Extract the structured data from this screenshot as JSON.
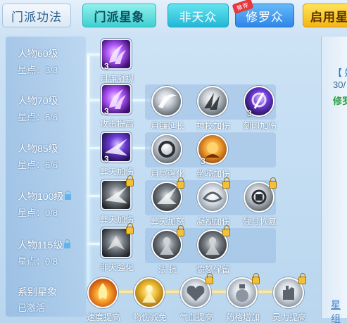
{
  "tabs": [
    {
      "label": "门派功法",
      "style": "plain",
      "active": false
    },
    {
      "label": "门派星象",
      "style": "active",
      "active": true
    },
    {
      "label": "非天众",
      "style": "cyan",
      "active": false
    },
    {
      "label": "修罗众",
      "style": "blue",
      "active": false,
      "badge": "推荐"
    },
    {
      "label": "启用星",
      "style": "yellow",
      "active": false
    }
  ],
  "levels": [
    {
      "name": "人物60级",
      "stars": "星点：3/3",
      "locked": false
    },
    {
      "name": "人物70级",
      "stars": "星点：6/6",
      "locked": false
    },
    {
      "name": "人物85级",
      "stars": "星点：6/6",
      "locked": false
    },
    {
      "name": "人物100级",
      "stars": "星点：0/8",
      "locked": true
    },
    {
      "name": "人物115级",
      "stars": "星点：0/8",
      "locked": true
    }
  ],
  "rows": [
    {
      "nodes": [
        {
          "label": "月镰凝视",
          "count": "3",
          "icon": "purple-claw-icon",
          "style": "ic-purple",
          "shape": "sq",
          "locked": false
        }
      ]
    },
    {
      "nodes": [
        {
          "label": "攻击提高",
          "count": "3",
          "icon": "purple-claw-icon",
          "style": "ic-purple",
          "shape": "sq",
          "locked": false
        },
        {
          "label": "月镰延长",
          "count": "",
          "icon": "crescent-blade-icon",
          "style": "ic-grey",
          "shape": "round",
          "locked": false
        },
        {
          "label": "神技加伤",
          "count": "",
          "icon": "claw-slash-icon",
          "style": "ic-grey",
          "shape": "round",
          "locked": false
        },
        {
          "label": "刻印加伤",
          "count": "3",
          "icon": "purple-rune-icon",
          "style": "ic-purple-dark",
          "shape": "round",
          "locked": false
        }
      ]
    },
    {
      "nodes": [
        {
          "label": "葬天加伤",
          "count": "3",
          "icon": "dark-burst-icon",
          "style": "ic-purple-dark",
          "shape": "sq",
          "locked": false
        },
        {
          "label": "月冥强化",
          "count": "",
          "icon": "moon-ring-icon",
          "style": "ic-grey",
          "shape": "round",
          "locked": false
        },
        {
          "label": "坐骑加伤",
          "count": "3",
          "icon": "fire-beast-icon",
          "style": "ic-orange",
          "shape": "round",
          "locked": false
        }
      ]
    },
    {
      "nodes": [
        {
          "label": "葬天加伤",
          "count": "",
          "icon": "grey-burst-icon",
          "style": "ic-grey-dark",
          "shape": "sq",
          "locked": true
        },
        {
          "label": "葬天加怒",
          "count": "",
          "icon": "grey-burst-icon",
          "style": "ic-grey-dark",
          "shape": "round",
          "locked": true
        },
        {
          "label": "凝视加伤",
          "count": "",
          "icon": "swirl-eye-icon",
          "style": "ic-silver",
          "shape": "round",
          "locked": true
        },
        {
          "label": "残月恢复",
          "count": "",
          "icon": "moon-lock-icon",
          "style": "ic-grey",
          "shape": "round",
          "locked": true
        }
      ]
    },
    {
      "nodes": [
        {
          "label": "非天强化",
          "count": "",
          "icon": "winged-demon-icon",
          "style": "ic-grey-dark",
          "shape": "sq",
          "locked": true
        },
        {
          "label": "法 抗",
          "count": "",
          "icon": "demon-figure-icon",
          "style": "ic-grey-dark",
          "shape": "round",
          "locked": true
        },
        {
          "label": "愤怒保留",
          "count": "",
          "icon": "demon-figure-icon",
          "style": "ic-grey-dark",
          "shape": "round",
          "locked": true
        }
      ]
    }
  ],
  "series": {
    "title": "系别星象",
    "state": "已激活",
    "nodes": [
      {
        "label": "速度提高",
        "icon": "flame-icon",
        "style": "ic-fire",
        "locked": false
      },
      {
        "label": "物伤减免",
        "icon": "golden-figure-icon",
        "style": "ic-gold",
        "locked": false
      },
      {
        "label": "气血提高",
        "icon": "heart-icon",
        "style": "ic-silver",
        "locked": true
      },
      {
        "label": "药格增加",
        "icon": "potion-bottle-icon",
        "style": "ic-silver",
        "locked": true
      },
      {
        "label": "灵力提高",
        "icon": "spirit-hand-icon",
        "style": "ic-silver",
        "locked": true
      }
    ]
  },
  "right_panel": {
    "line1": "【 妹",
    "line2": "30/",
    "line3": "修罗",
    "link": "星 组"
  }
}
